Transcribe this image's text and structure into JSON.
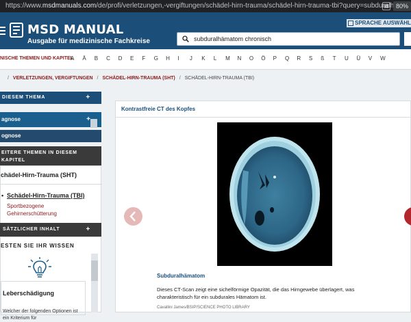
{
  "browser": {
    "url_scheme": "https://www.",
    "url_host": "msdmanuals.com",
    "url_path": "/de/profi/verletzungen,-vergiftungen/schädel-hirn-trauma/schädel-hirn-trauma-tbi?query=subduralhämato",
    "zoom": "80%"
  },
  "header": {
    "brand": "MSD MANUAL",
    "tagline": "Ausgabe für medizinische Fachkreise",
    "language_button": "SPRACHE AUSWÄHLEN",
    "search_value": "subduralhämatom chronisch"
  },
  "alphabet": {
    "lead": "NISCHE THEMEN UND KAPITEL",
    "letters": [
      "A",
      "Ä",
      "B",
      "C",
      "D",
      "E",
      "F",
      "G",
      "H",
      "I",
      "J",
      "K",
      "L",
      "M",
      "N",
      "O",
      "Ö",
      "P",
      "Q",
      "R",
      "S",
      "ß",
      "T",
      "U",
      "Ü",
      "V",
      "W"
    ]
  },
  "breadcrumb": {
    "home_sep": "/",
    "level1": "VERLETZUNGEN, VERGIFTUNGEN",
    "level2": "SCHÄDEL-HIRN-TRAUMA (SHT)",
    "level3": "SCHÄDEL-HIRN-TRAUMA (TBI)",
    "sep": "/"
  },
  "sidebar": {
    "in_topic": "DIESEM THEMA",
    "item1": "agnose",
    "item2": "ognose",
    "more_topics": "EITERE THEMEN IN DIESEM KAPITEL",
    "parent": "chädel-Hirn-Trauma (SHT)",
    "current": "Schädel-Hirn-Trauma (TBI)",
    "related": "Sportbezogene Gehirnerschütterung",
    "extra": "SÄTZLICHER INHALT",
    "quiz_title": "ESTEN SIE IHR WISSEN",
    "quiz_card_title": "Leberschädigung",
    "quiz_card_text": "Welcher der folgenden Optionen ist ein Kriterium für",
    "plus": "+"
  },
  "main": {
    "title": "Kontrastfreie CT des Kopfes",
    "caption_title": "Subduralhämatom",
    "caption_text": "Dieses CT-Scan zeigt eine sichelförmige Opazität, die das Hirngewebe überlagert, was charakteristisch für ein subdurales Hämatom ist.",
    "credit": "Cavallini James/BSIP/SCIENCE PHOTO LIBRARY"
  },
  "colors": {
    "header": "#1b4f7a",
    "accent": "#8a1a1a",
    "arrow_next": "#b3262b",
    "arrow_prev": "#e6b9b9"
  }
}
